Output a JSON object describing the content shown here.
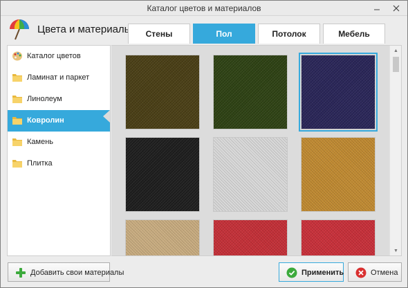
{
  "window": {
    "title": "Каталог цветов и материалов"
  },
  "header": {
    "app_title": "Цвета и материалы"
  },
  "tabs": [
    {
      "label": "Стены",
      "active": false
    },
    {
      "label": "Пол",
      "active": true
    },
    {
      "label": "Потолок",
      "active": false
    },
    {
      "label": "Мебель",
      "active": false
    }
  ],
  "sidebar": {
    "items": [
      {
        "label": "Каталог цветов",
        "icon": "palette-icon",
        "active": false
      },
      {
        "label": "Ламинат и паркет",
        "icon": "folder-icon",
        "active": false
      },
      {
        "label": "Линолеум",
        "icon": "folder-icon",
        "active": false
      },
      {
        "label": "Ковролин",
        "icon": "folder-icon",
        "active": true
      },
      {
        "label": "Камень",
        "icon": "folder-icon",
        "active": false
      },
      {
        "label": "Плитка",
        "icon": "folder-icon",
        "active": false
      }
    ]
  },
  "swatches": [
    {
      "color": "#4a3f16",
      "selected": false
    },
    {
      "color": "#2e4214",
      "selected": false
    },
    {
      "color": "#2a2658",
      "selected": true
    },
    {
      "color": "#1e1e1e",
      "selected": false
    },
    {
      "color": "#d8d8d8",
      "selected": false
    },
    {
      "color": "#c08a32",
      "selected": false
    },
    {
      "color": "#c8ac80",
      "selected": false
    },
    {
      "color": "#c43038",
      "selected": false
    },
    {
      "color": "#c8303a",
      "selected": false
    }
  ],
  "footer": {
    "add_label": "Добавить свои материалы",
    "apply_label": "Применить",
    "cancel_label": "Отмена"
  },
  "colors": {
    "accent": "#36a9dc"
  }
}
